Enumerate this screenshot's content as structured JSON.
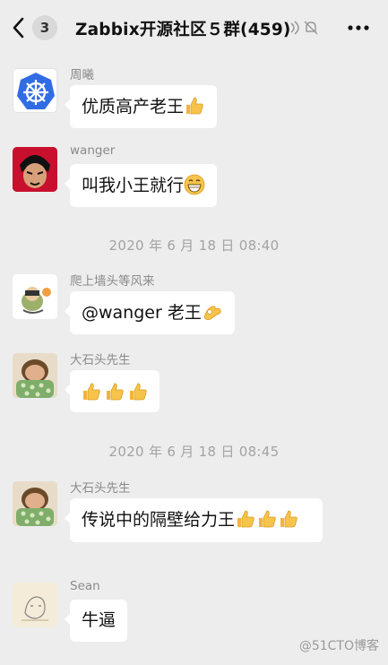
{
  "header": {
    "unread_count": "3",
    "title": "Zabbix开源社区５群(459)"
  },
  "messages": [
    {
      "sender": "周曦",
      "text": "优质高产老王"
    },
    {
      "sender": "wanger",
      "text": "叫我小王就行"
    },
    {
      "sender": "爬上墙头等风来",
      "text": "@wanger 老王"
    },
    {
      "sender": "大石头先生",
      "text": ""
    },
    {
      "sender": "大石头先生",
      "text": "传说中的隔壁给力王"
    },
    {
      "sender": "Sean",
      "text": "牛逼"
    }
  ],
  "timestamps": [
    "2020 年 6 月 18 日  08:40",
    "2020 年 6 月 18 日  08:45"
  ],
  "watermark": "@51CTO博客",
  "colors": {
    "background": "#ededed",
    "bubble": "#ffffff",
    "meta_text": "#a3a3a3"
  },
  "icons": [
    "back-chevron-icon",
    "voice-icon",
    "mute-bell-icon",
    "more-icon",
    "thumbs-up-emoji",
    "grin-emoji",
    "ok-hand-emoji"
  ]
}
